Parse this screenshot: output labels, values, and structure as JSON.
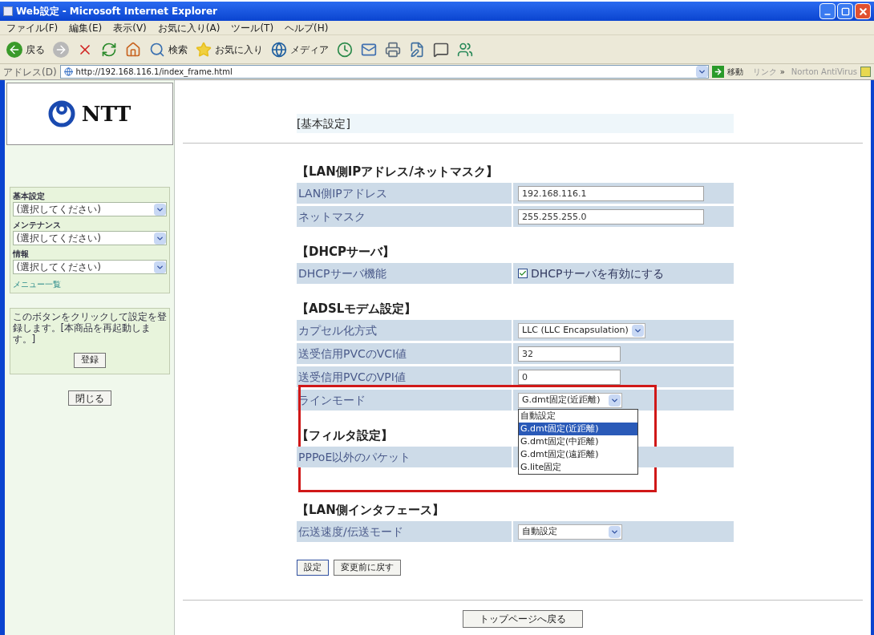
{
  "window": {
    "title": "Web設定 - Microsoft Internet Explorer"
  },
  "menu": [
    "ファイル(F)",
    "編集(E)",
    "表示(V)",
    "お気に入り(A)",
    "ツール(T)",
    "ヘルプ(H)"
  ],
  "toolbar": [
    {
      "kind": "back",
      "label": "戻る"
    },
    {
      "kind": "forward"
    },
    {
      "kind": "stop"
    },
    {
      "kind": "refresh"
    },
    {
      "kind": "home"
    },
    {
      "kind": "search",
      "label": "検索"
    },
    {
      "kind": "favorites",
      "label": "お気に入り"
    },
    {
      "kind": "media",
      "label": "メディア"
    },
    {
      "kind": "history"
    },
    {
      "kind": "mail"
    },
    {
      "kind": "print"
    },
    {
      "kind": "edit"
    },
    {
      "kind": "discuss"
    },
    {
      "kind": "messenger"
    }
  ],
  "address_bar": {
    "label": "アドレス(D)",
    "url": "http://192.168.116.1/index_frame.html",
    "go": "移動",
    "links": "リンク",
    "more": "»",
    "plugin": "Norton AntiVirus"
  },
  "sidebar": {
    "logo": "NTT",
    "menus": [
      {
        "label": "基本設定",
        "value": "(選択してください)"
      },
      {
        "label": "メンテナンス",
        "value": "(選択してください)"
      },
      {
        "label": "情報",
        "value": "(選択してください)"
      }
    ],
    "menu_link": "メニュー一覧",
    "note": "このボタンをクリックして設定を登録します。[本商品を再起動します。]",
    "register_button": "登録",
    "close_button": "閉じる"
  },
  "main": {
    "header": "[基本設定]",
    "sections": [
      {
        "title": "【LAN側IPアドレス/ネットマスク】",
        "rows": [
          {
            "label": "LAN側IPアドレス",
            "kind": "input",
            "value": "192.168.116.1",
            "wide": true,
            "framed": false
          },
          {
            "label": "ネットマスク",
            "kind": "input",
            "value": "255.255.255.0",
            "wide": true,
            "framed": false
          }
        ]
      },
      {
        "title": "【DHCPサーバ】",
        "rows": [
          {
            "label": "DHCPサーバ機能",
            "kind": "checkbox",
            "value": "DHCPサーバを有効にする",
            "checked": true,
            "framed": false
          }
        ]
      },
      {
        "title": "【ADSLモデム設定】",
        "rows": [
          {
            "label": "カプセル化方式",
            "kind": "select",
            "value": "LLC (LLC Encapsulation)",
            "framed": false
          },
          {
            "label": "送受信用PVCのVCI値",
            "kind": "input",
            "value": "32",
            "wide": false,
            "framed": false
          },
          {
            "label": "送受信用PVCのVPI値",
            "kind": "input",
            "value": "0",
            "wide": false,
            "framed": false
          },
          {
            "label": "ラインモード",
            "kind": "open_select",
            "value": "G.dmt固定(近距離)",
            "framed": true,
            "options": [
              {
                "label": "自動設定",
                "selected": false
              },
              {
                "label": "G.dmt固定(近距離)",
                "selected": true
              },
              {
                "label": "G.dmt固定(中距離)",
                "selected": false
              },
              {
                "label": "G.dmt固定(遠距離)",
                "selected": false
              },
              {
                "label": "G.lite固定",
                "selected": false
              }
            ]
          }
        ]
      },
      {
        "title": "【フィルタ設定】",
        "rows": [
          {
            "label": "PPPoE以外のパケット",
            "kind": "blank",
            "framed": false
          }
        ]
      },
      {
        "title": "【LAN側インタフェース】",
        "rows": [
          {
            "label": "伝送速度/伝送モード",
            "kind": "select",
            "value": "自動設定",
            "framed": false
          }
        ]
      }
    ],
    "buttons": [
      "設定",
      "変更前に戻す"
    ],
    "top_button": "トップページへ戻る"
  }
}
